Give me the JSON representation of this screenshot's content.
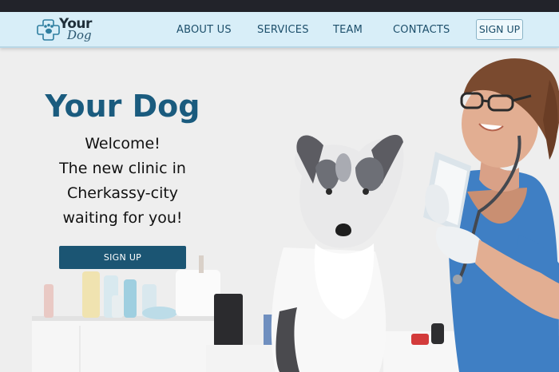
{
  "brand": {
    "line1": "Your",
    "line2": "Dog"
  },
  "nav": {
    "items": [
      {
        "label": "ABOUT US"
      },
      {
        "label": "SERVICES"
      },
      {
        "label": "TEAM"
      },
      {
        "label": "CONTACTS"
      }
    ],
    "signup_label": "SIGN UP"
  },
  "hero": {
    "title": "Your Dog",
    "lines": [
      "Welcome!",
      "The new clinic in",
      "Cherkassy-city",
      "waiting for you!"
    ],
    "button_label": "SIGN UP"
  },
  "colors": {
    "primary": "#1b5573",
    "nav_background": "#d8eef8",
    "topbar": "#22232a"
  },
  "icons": {
    "logo": "paw-cross-icon"
  }
}
